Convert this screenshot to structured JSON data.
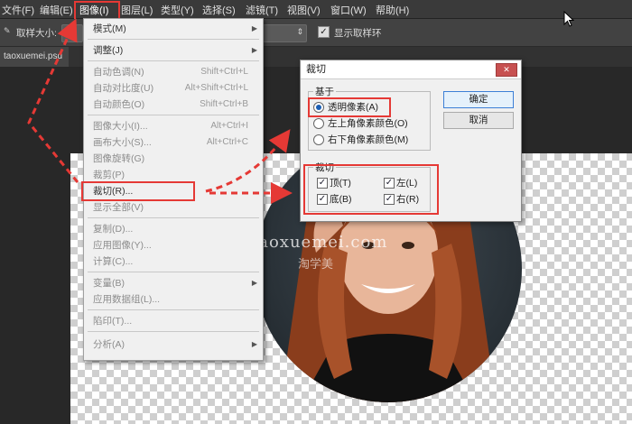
{
  "menubar": {
    "items": [
      "文件(F)",
      "编辑(E)",
      "图像(I)",
      "图层(L)",
      "类型(Y)",
      "选择(S)",
      "滤镜(T)",
      "视图(V)",
      "窗口(W)",
      "帮助(H)"
    ]
  },
  "options_bar": {
    "sample_size_label": "取样大小:",
    "sample_value": "取",
    "show_ring_label": "显示取样环"
  },
  "doc_tab": "taoxuemei.psd",
  "image_menu": {
    "items": [
      {
        "label": "模式(M)",
        "shortcut": "",
        "submenu": true,
        "disabled": false
      },
      {
        "label": "调整(J)",
        "shortcut": "",
        "submenu": true,
        "disabled": false
      },
      {
        "label": "自动色调(N)",
        "shortcut": "Shift+Ctrl+L",
        "submenu": false,
        "disabled": true
      },
      {
        "label": "自动对比度(U)",
        "shortcut": "Alt+Shift+Ctrl+L",
        "submenu": false,
        "disabled": true
      },
      {
        "label": "自动颜色(O)",
        "shortcut": "Shift+Ctrl+B",
        "submenu": false,
        "disabled": true
      },
      {
        "label": "图像大小(I)...",
        "shortcut": "Alt+Ctrl+I",
        "submenu": false,
        "disabled": false
      },
      {
        "label": "画布大小(S)...",
        "shortcut": "Alt+Ctrl+C",
        "submenu": false,
        "disabled": false
      },
      {
        "label": "图像旋转(G)",
        "shortcut": "",
        "submenu": true,
        "disabled": false
      },
      {
        "label": "裁剪(P)",
        "shortcut": "",
        "submenu": false,
        "disabled": true
      },
      {
        "label": "裁切(R)...",
        "shortcut": "",
        "submenu": false,
        "disabled": false
      },
      {
        "label": "显示全部(V)",
        "shortcut": "",
        "submenu": false,
        "disabled": true
      },
      {
        "label": "复制(D)...",
        "shortcut": "",
        "submenu": false,
        "disabled": false
      },
      {
        "label": "应用图像(Y)...",
        "shortcut": "",
        "submenu": false,
        "disabled": false
      },
      {
        "label": "计算(C)...",
        "shortcut": "",
        "submenu": false,
        "disabled": false
      },
      {
        "label": "变量(B)",
        "shortcut": "",
        "submenu": true,
        "disabled": true
      },
      {
        "label": "应用数据组(L)...",
        "shortcut": "",
        "submenu": false,
        "disabled": true
      },
      {
        "label": "陷印(T)...",
        "shortcut": "",
        "submenu": false,
        "disabled": true
      },
      {
        "label": "分析(A)",
        "shortcut": "",
        "submenu": true,
        "disabled": false
      }
    ]
  },
  "trim_dialog": {
    "title": "裁切",
    "based_on_label": "基于",
    "option_transparent": "透明像素(A)",
    "option_top_left": "左上角像素颜色(O)",
    "option_bottom_right": "右下角像素颜色(M)",
    "trim_away_label": "裁切",
    "chk_top": "顶(T)",
    "chk_left": "左(L)",
    "chk_bottom": "底(B)",
    "chk_right": "右(R)",
    "ok_label": "确定",
    "cancel_label": "取消"
  },
  "watermark": {
    "text": "taoxuemei.com",
    "sub": "淘学美"
  },
  "colors": {
    "highlight_red": "#e53935",
    "dark_bg": "#282828"
  }
}
